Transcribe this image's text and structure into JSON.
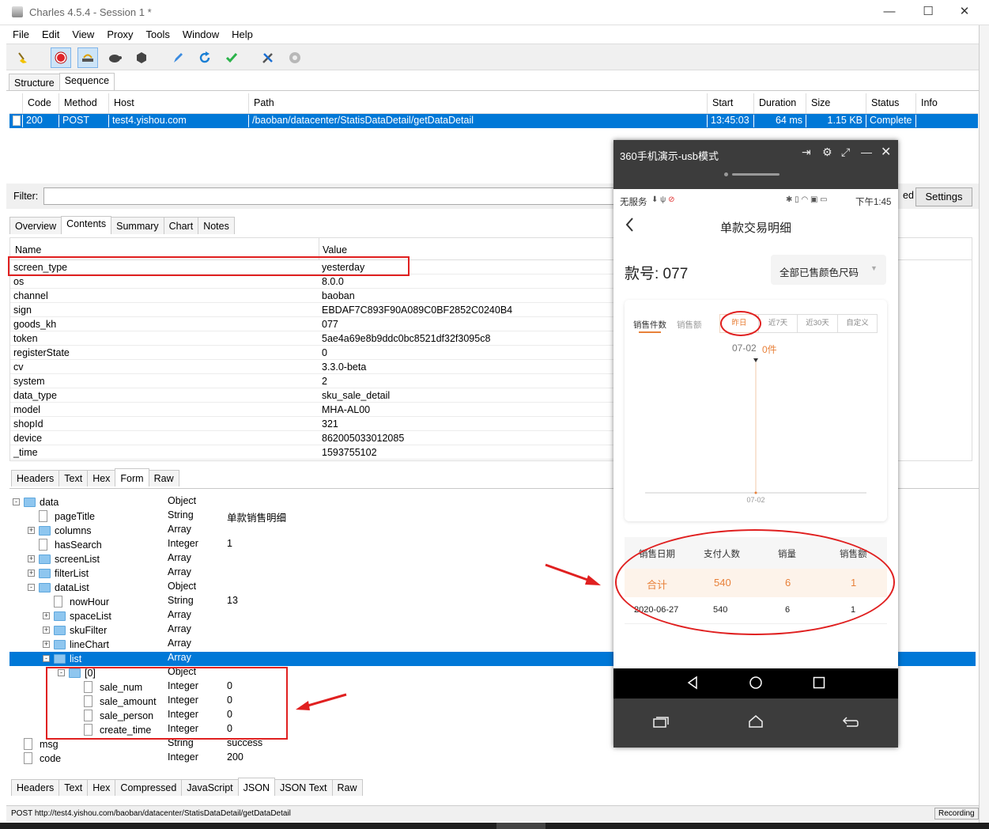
{
  "window": {
    "title": "Charles 4.5.4 - Session 1 *",
    "controls": {
      "minimize": "—",
      "maximize": "☐",
      "close": "✕"
    }
  },
  "menu": [
    "File",
    "Edit",
    "View",
    "Proxy",
    "Tools",
    "Window",
    "Help"
  ],
  "toolbar": {
    "icons": [
      "broom-icon",
      "record-icon",
      "throttle-icon",
      "turtle-icon",
      "hexagon-icon",
      "pen-icon",
      "refresh-icon",
      "check-icon",
      "tools-icon",
      "gear-icon"
    ]
  },
  "view_tabs": [
    "Structure",
    "Sequence"
  ],
  "sequence_table": {
    "columns": [
      "Code",
      "Method",
      "Host",
      "Path",
      "Start",
      "Duration",
      "Size",
      "Status",
      "Info"
    ],
    "rows": [
      {
        "code": "200",
        "method": "POST",
        "host": "test4.yishou.com",
        "path": "/baoban/datacenter/StatisDataDetail/getDataDetail",
        "start": "13:45:03",
        "duration": "64 ms",
        "size": "1.15 KB",
        "status": "Complete",
        "info": ""
      }
    ]
  },
  "filter": {
    "label": "Filter:",
    "value": "",
    "partial_text": "ed",
    "settings_label": "Settings"
  },
  "detail_tabs": [
    "Overview",
    "Contents",
    "Summary",
    "Chart",
    "Notes"
  ],
  "request_params": {
    "columns": [
      "Name",
      "Value"
    ],
    "rows": [
      {
        "name": "screen_type",
        "value": "yesterday"
      },
      {
        "name": "os",
        "value": "8.0.0"
      },
      {
        "name": "channel",
        "value": "baoban"
      },
      {
        "name": "sign",
        "value": "EBDAF7C893F90A089C0BF2852C0240B4"
      },
      {
        "name": "goods_kh",
        "value": "077"
      },
      {
        "name": "token",
        "value": "5ae4a69e8b9ddc0bc8521df32f3095c8"
      },
      {
        "name": "registerState",
        "value": "0"
      },
      {
        "name": "cv",
        "value": "3.3.0-beta"
      },
      {
        "name": "system",
        "value": "2"
      },
      {
        "name": "data_type",
        "value": "sku_sale_detail"
      },
      {
        "name": "model",
        "value": "MHA-AL00"
      },
      {
        "name": "shopId",
        "value": "321"
      },
      {
        "name": "device",
        "value": "862005033012085"
      },
      {
        "name": "_time",
        "value": "1593755102"
      }
    ]
  },
  "request_tabs": [
    "Headers",
    "Text",
    "Hex",
    "Form",
    "Raw"
  ],
  "response_tree": [
    {
      "name": "data",
      "type": "Object",
      "value": "",
      "depth": 0,
      "kind": "folder",
      "toggle": "-"
    },
    {
      "name": "pageTitle",
      "type": "String",
      "value": "单款销售明细",
      "depth": 1,
      "kind": "file",
      "toggle": ""
    },
    {
      "name": "columns",
      "type": "Array",
      "value": "",
      "depth": 1,
      "kind": "folder",
      "toggle": "+"
    },
    {
      "name": "hasSearch",
      "type": "Integer",
      "value": "1",
      "depth": 1,
      "kind": "file",
      "toggle": ""
    },
    {
      "name": "screenList",
      "type": "Array",
      "value": "",
      "depth": 1,
      "kind": "folder",
      "toggle": "+"
    },
    {
      "name": "filterList",
      "type": "Array",
      "value": "",
      "depth": 1,
      "kind": "folder",
      "toggle": "+"
    },
    {
      "name": "dataList",
      "type": "Object",
      "value": "",
      "depth": 1,
      "kind": "folder",
      "toggle": "-"
    },
    {
      "name": "nowHour",
      "type": "String",
      "value": "13",
      "depth": 2,
      "kind": "file",
      "toggle": ""
    },
    {
      "name": "spaceList",
      "type": "Array",
      "value": "",
      "depth": 2,
      "kind": "folder",
      "toggle": "+"
    },
    {
      "name": "skuFilter",
      "type": "Array",
      "value": "",
      "depth": 2,
      "kind": "folder",
      "toggle": "+"
    },
    {
      "name": "lineChart",
      "type": "Array",
      "value": "",
      "depth": 2,
      "kind": "folder",
      "toggle": "+"
    },
    {
      "name": "list",
      "type": "Array",
      "value": "",
      "depth": 2,
      "kind": "folder",
      "toggle": "-",
      "selected": true
    },
    {
      "name": "[0]",
      "type": "Object",
      "value": "",
      "depth": 3,
      "kind": "folder",
      "toggle": "-"
    },
    {
      "name": "sale_num",
      "type": "Integer",
      "value": "0",
      "depth": 4,
      "kind": "file",
      "toggle": ""
    },
    {
      "name": "sale_amount",
      "type": "Integer",
      "value": "0",
      "depth": 4,
      "kind": "file",
      "toggle": ""
    },
    {
      "name": "sale_person",
      "type": "Integer",
      "value": "0",
      "depth": 4,
      "kind": "file",
      "toggle": ""
    },
    {
      "name": "create_time",
      "type": "Integer",
      "value": "0",
      "depth": 4,
      "kind": "file",
      "toggle": ""
    },
    {
      "name": "msg",
      "type": "String",
      "value": "success",
      "depth": 0,
      "kind": "file",
      "toggle": ""
    },
    {
      "name": "code",
      "type": "Integer",
      "value": "200",
      "depth": 0,
      "kind": "file",
      "toggle": ""
    }
  ],
  "response_tabs": [
    "Headers",
    "Text",
    "Hex",
    "Compressed",
    "JavaScript",
    "JSON",
    "JSON Text",
    "Raw"
  ],
  "statusline": {
    "text": "POST http://test4.yishou.com/baoban/datacenter/StatisDataDetail/getDataDetail",
    "recording": "Recording"
  },
  "phone": {
    "window_title": "360手机演示-usb模式",
    "status_left": "无服务",
    "status_right": "下午1:45",
    "page_title": "单款交易明细",
    "product_label": "款号: 077",
    "filter_label": "全部已售颜色尺码",
    "metric_tabs": [
      "销售件数",
      "销售额"
    ],
    "range_buttons": [
      "昨日",
      "近7天",
      "近30天",
      "自定义"
    ],
    "chart_data": {
      "type": "line",
      "categories": [
        "07-02"
      ],
      "values": [
        0
      ],
      "tooltip_date": "07-02",
      "tooltip_value": "0件",
      "x_tick": "07-02"
    },
    "table": {
      "columns": [
        "销售日期",
        "支付人数",
        "销量",
        "销售额"
      ],
      "total_row": [
        "合计",
        "540",
        "6",
        "1"
      ],
      "rows": [
        [
          "2020-06-27",
          "540",
          "6",
          "1"
        ]
      ]
    },
    "colors": {
      "accent": "#e8813a",
      "header_bg": "#3c3c3c"
    }
  }
}
